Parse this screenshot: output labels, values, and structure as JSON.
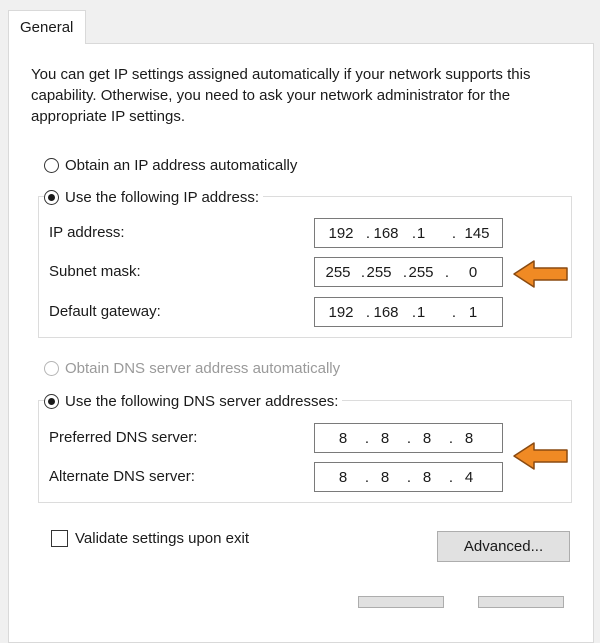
{
  "tab": {
    "label": "General"
  },
  "intro": "You can get IP settings assigned automatically if your network supports this capability. Otherwise, you need to ask your network administrator for the appropriate IP settings.",
  "ip_section": {
    "auto_label": "Obtain an IP address automatically",
    "manual_label": "Use the following IP address:",
    "selected": "manual",
    "fields": {
      "ip": {
        "label": "IP address:",
        "octets": [
          "192",
          "168",
          "1",
          "145"
        ]
      },
      "subnet": {
        "label": "Subnet mask:",
        "octets": [
          "255",
          "255",
          "255",
          "0"
        ]
      },
      "gateway": {
        "label": "Default gateway:",
        "octets": [
          "192",
          "168",
          "1",
          "1"
        ]
      }
    }
  },
  "dns_section": {
    "auto_label": "Obtain DNS server address automatically",
    "auto_disabled": true,
    "manual_label": "Use the following DNS server addresses:",
    "selected": "manual",
    "fields": {
      "preferred": {
        "label": "Preferred DNS server:",
        "octets": [
          "8",
          "8",
          "8",
          "8"
        ]
      },
      "alternate": {
        "label": "Alternate DNS server:",
        "octets": [
          "8",
          "8",
          "8",
          "4"
        ]
      }
    }
  },
  "validate": {
    "label": "Validate settings upon exit",
    "checked": false
  },
  "advanced_button": "Advanced...",
  "colors": {
    "arrow": "#f08a24",
    "arrow_outline": "#8a4a10"
  },
  "icons": [
    "orange-arrow-icon"
  ]
}
